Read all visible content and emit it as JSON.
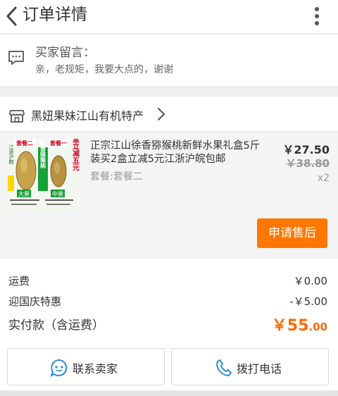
{
  "header": {
    "title": "订单详情"
  },
  "buyer_message": {
    "label": "买家留言：",
    "text": "亲，老规矩，我要大点的，谢谢"
  },
  "shop": {
    "name": "黑妞果妹江山有机特产"
  },
  "item": {
    "title": "正宗江山徐香猕猴桃新鲜水果礼盒5斤装买2盒立减5元江浙沪皖包邮",
    "spec": "套餐:套餐二",
    "price": "￥27.50",
    "original_price": "￥38.80",
    "quantity": "x2",
    "after_sale_label": "申请售后",
    "thumb": {
      "tag_left": "套餐二",
      "tag_right": "套餐一",
      "side_left": "江浙沪皖",
      "box_text": "2盒5斤包邮",
      "center_text": "徐香猕猴桃",
      "right_text": "买2盒立减五元",
      "big_label": "大果",
      "mid_label": "中果"
    }
  },
  "summary": {
    "shipping_label": "运费",
    "shipping_value": "￥0.00",
    "discount_label": "迎国庆特惠",
    "discount_value": "-￥5.00",
    "total_label": "实付款（含运费）",
    "total_currency": "￥",
    "total_int": "55",
    "total_dec": ".00"
  },
  "actions": {
    "contact_label": "联系卖家",
    "call_label": "拨打电话"
  },
  "colors": {
    "accent": "#ff7700",
    "total": "#ff6a00",
    "icon_blue": "#2b8ae0"
  }
}
